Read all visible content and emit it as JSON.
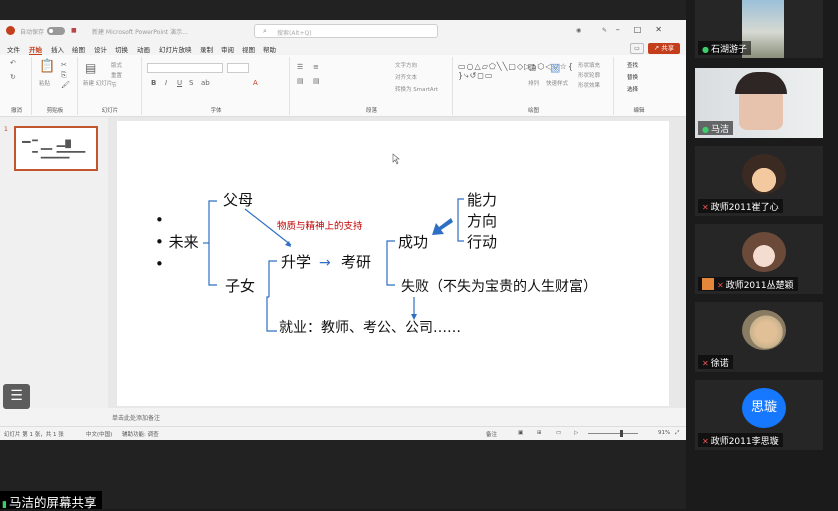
{
  "ppt": {
    "titlebar": {
      "autosave": "自动保存",
      "doc_title": "新建 Microsoft PowerPoint 演示...",
      "search_placeholder": "搜索(Alt+Q)"
    },
    "menus": [
      "文件",
      "开始",
      "插入",
      "绘图",
      "设计",
      "切换",
      "动画",
      "幻灯片放映",
      "录制",
      "审阅",
      "视图",
      "帮助"
    ],
    "active_menu": "开始",
    "share_label": "共享",
    "ribbon": {
      "groups": [
        "撤消",
        "剪贴板",
        "幻灯片",
        "字体",
        "段落",
        "绘图",
        "编辑"
      ],
      "paste_label": "粘贴",
      "new_slide_label": "新建\n幻灯片",
      "layout_label": "版式",
      "reset_label": "重置",
      "section_label": "节",
      "text_direction": "文字方向",
      "align_text": "对齐文本",
      "convert_smartart": "转换为 SmartArt",
      "arrange_label": "排列",
      "quick_styles": "快速样式",
      "shape_fill": "形状填充",
      "shape_outline": "形状轮廓",
      "shape_effects": "形状效果",
      "find_label": "查找",
      "replace_label": "替换",
      "select_label": "选择"
    },
    "slide_number": "1",
    "slide": {
      "bullets": [
        "•",
        "• 未来",
        "•"
      ],
      "parents": "父母",
      "support": "物质与精神上的支持",
      "children": "子女",
      "further_study": "升学",
      "arrow": "→",
      "kaoyan": "考研",
      "success": "成功",
      "ability": "能力",
      "direction": "方向",
      "action": "行动",
      "failure": "失败（不失为宝贵的人生财富）",
      "employment": "就业：教师、考公、公司……"
    },
    "notes_placeholder": "单击此处添加备注",
    "statusbar": {
      "slide_info": "幻灯片 第 1 张，共 1 张",
      "language": "中文(中国)",
      "accessibility": "辅助功能: 调查",
      "notes": "备注",
      "zoom": "91%"
    }
  },
  "meeting": {
    "share_banner": "马洁的屏幕共享",
    "participants": [
      {
        "name": "石湖游子",
        "mic": "on"
      },
      {
        "name": "马洁",
        "mic": "on"
      },
      {
        "name": "政师2011崔了心",
        "mic": "off"
      },
      {
        "name": "政师2011丛楚颖",
        "mic": "off",
        "host": true
      },
      {
        "name": "徐诺",
        "mic": "off"
      },
      {
        "name": "政师2011李思璇",
        "mic": "off",
        "avatar_text": "思璇"
      }
    ],
    "colors": {
      "accent": "#c43e1c",
      "avatar_blue": "#1677ff",
      "support_red": "#c00000",
      "arrow_blue": "#2e6fc4"
    }
  }
}
